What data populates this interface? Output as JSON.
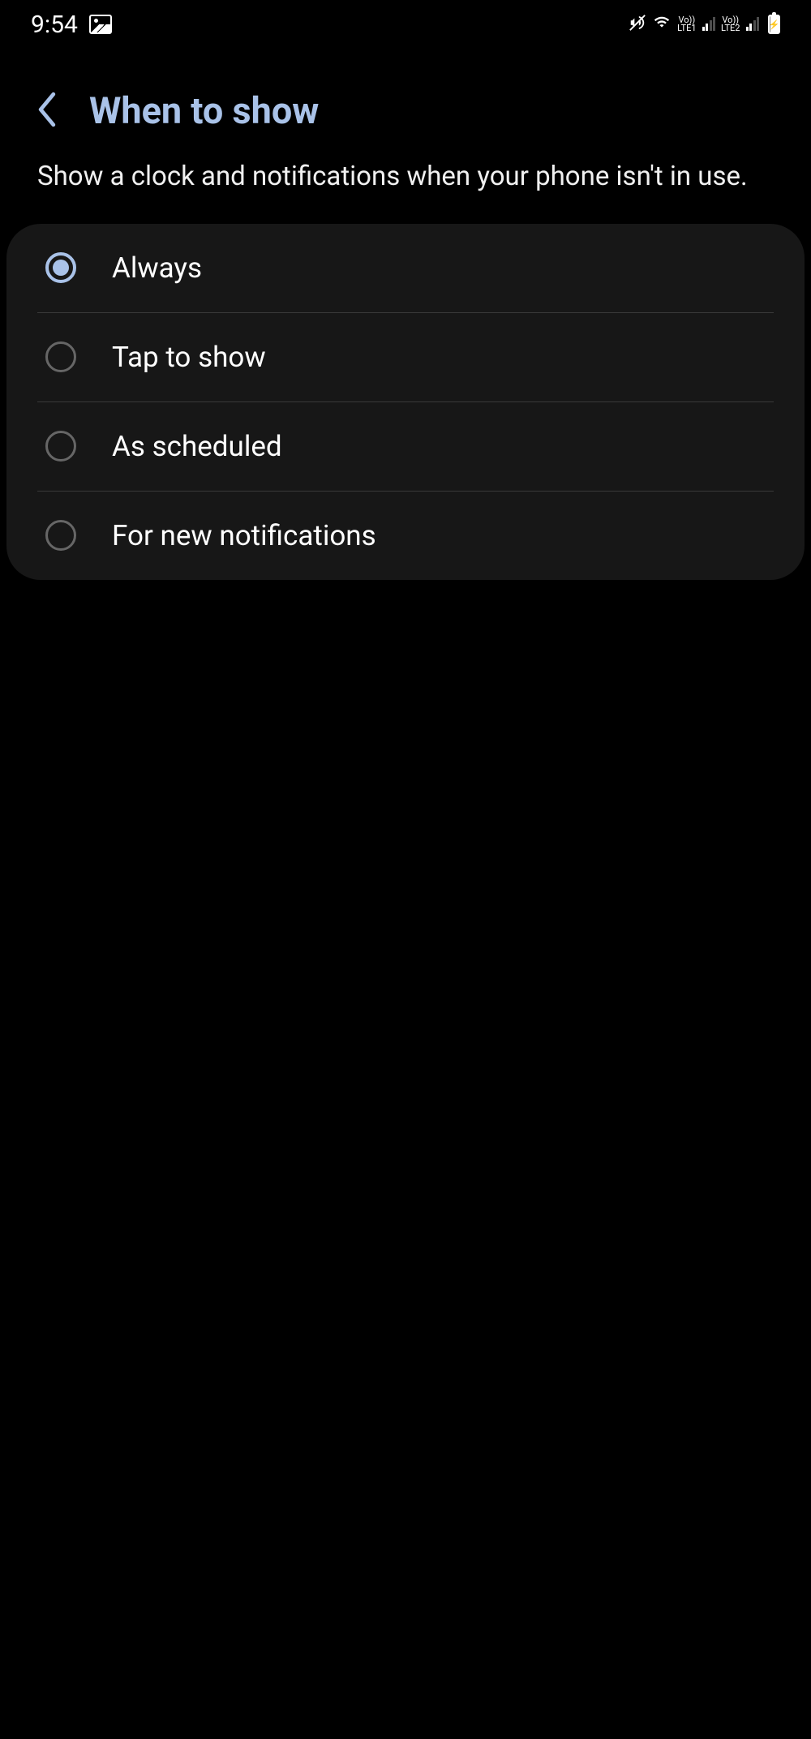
{
  "statusBar": {
    "time": "9:54",
    "sim1Label": "Vo))\nLTE1",
    "sim2Label": "Vo))\nLTE2"
  },
  "header": {
    "title": "When to show"
  },
  "description": "Show a clock and notifications when your phone isn't in use.",
  "options": [
    {
      "label": "Always",
      "selected": true
    },
    {
      "label": "Tap to show",
      "selected": false
    },
    {
      "label": "As scheduled",
      "selected": false
    },
    {
      "label": "For new notifications",
      "selected": false
    }
  ]
}
